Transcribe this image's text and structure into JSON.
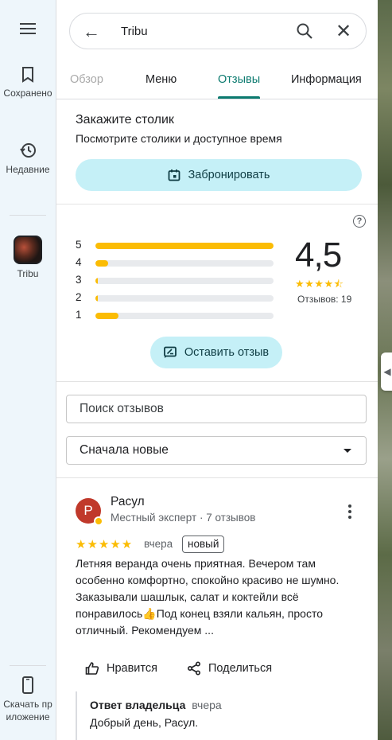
{
  "rail": {
    "saved_label": "Сохранено",
    "recent_label": "Недавние",
    "place_label": "Tribu",
    "download_label": "Скачать приложение"
  },
  "search": {
    "query": "Tribu"
  },
  "tabs": [
    {
      "label": "Обзор"
    },
    {
      "label": "Меню"
    },
    {
      "label": "Отзывы"
    },
    {
      "label": "Информация"
    }
  ],
  "reserve": {
    "title": "Закажите столик",
    "subtitle": "Посмотрите столики и доступное время",
    "button": "Забронировать"
  },
  "rating": {
    "value": "4,5",
    "stars": 4.5,
    "reviews": "Отзывов: 19",
    "distribution": [
      {
        "star": "5",
        "fraction": 1.0
      },
      {
        "star": "4",
        "fraction": 0.07
      },
      {
        "star": "3",
        "fraction": 0.01
      },
      {
        "star": "2",
        "fraction": 0.01
      },
      {
        "star": "1",
        "fraction": 0.13
      }
    ],
    "write_button": "Оставить отзыв"
  },
  "review_search": {
    "placeholder": "Поиск отзывов"
  },
  "sort": {
    "selected": "Сначала новые"
  },
  "review": {
    "avatar_letter": "Р",
    "author": "Расул",
    "meta": "Местный эксперт · 7 отзывов",
    "stars": 5,
    "date": "вчера",
    "badge": "новый",
    "text": "Летняя веранда очень приятная. Вечером там особенно комфортно, спокойно красиво не шумно. Заказывали шашлык, салат и коктейли всё понравилось👍Под конец взяли кальян, просто отличный. Рекомендуем ...",
    "like_label": "Нравится",
    "share_label": "Поделиться",
    "owner_reply": {
      "title": "Ответ владельца",
      "date": "вчера",
      "text": "Добрый день, Расул."
    }
  },
  "colors": {
    "accent": "#0b7a6f",
    "button_bg": "#c5f0f7",
    "star": "#fbbc04",
    "rail_bg": "#eef6fb"
  }
}
